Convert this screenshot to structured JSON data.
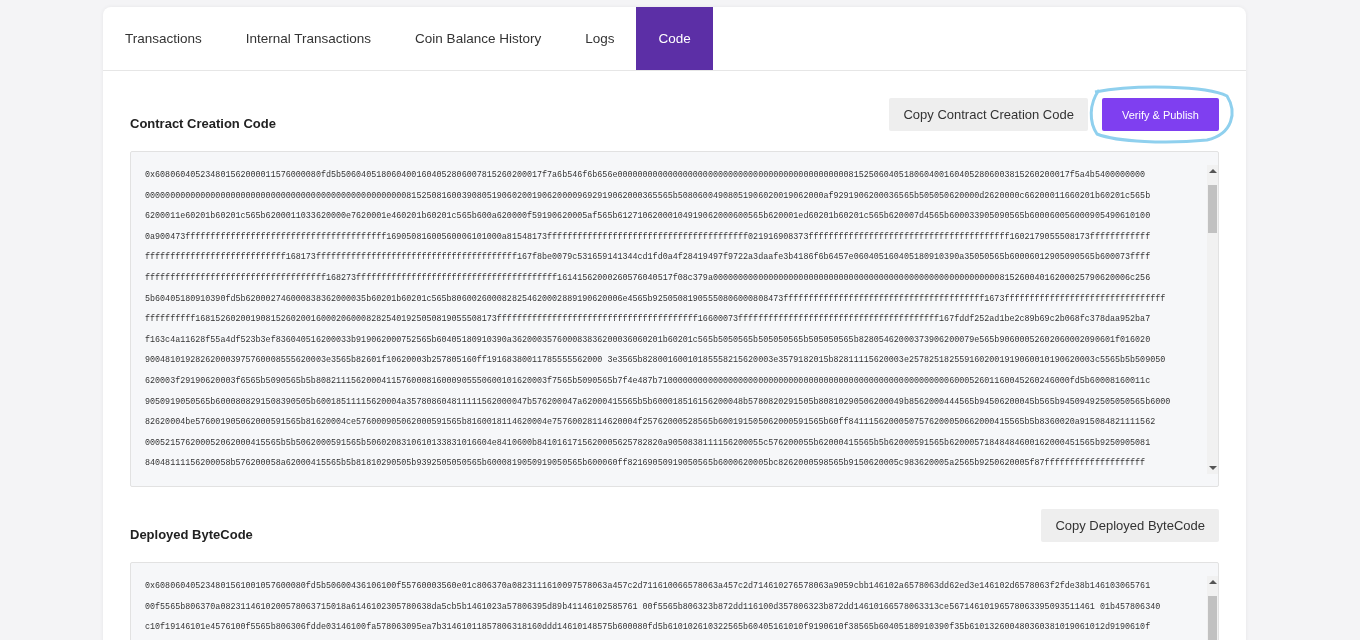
{
  "tabs": [
    {
      "label": "Transactions",
      "selected": false
    },
    {
      "label": "Internal Transactions",
      "selected": false
    },
    {
      "label": "Coin Balance History",
      "selected": false
    },
    {
      "label": "Logs",
      "selected": false
    },
    {
      "label": "Code",
      "selected": true
    }
  ],
  "sections": [
    {
      "title": "Contract Creation Code",
      "buttons": [
        {
          "label": "Copy Contract Creation Code",
          "kind": "secondary",
          "annotated": false
        },
        {
          "label": "Verify & Publish",
          "kind": "primary",
          "annotated": true
        }
      ],
      "code_lines": [
        "0x608060405234801562000011576000080fd5b5060405180604001604052806007815260200017f7a6b546f6b656e000000000000000000000000000000000000000000000081525060405180604001604052806003815260200017f5a4b5400000000",
        "000000000000000000000000000000000000000000000000000081525081600390805190602001906200009692919062000365565b50806004908051906020019062000af9291906200036565b505050620000d2620000c66200011660201b60201c565b",
        "6200011e60201b60201c565b6200011033620000e7620001e460201b60201c565b600a620000f59190620005af565b61271062000104919062000600565b620001ed60201b60201c565b620007d4565b600033905090565b600060056000905490610100",
        "0a900473ffffffffffffffffffffffffffffffffffffffff16905081600560006101000a81548173ffffffffffffffffffffffffffffffffffffffff021916908373ffffffffffffffffffffffffffffffffffffffff1602179055508173ffffffffffff",
        "ffffffffffffffffffffffffffff168173ffffffffffffffffffffffffffffffffffffffff167f8be0079c531659141344cd1fd0a4f28419497f9722a3daafe3b4186f6b6457e060405160405180910390a35050565b60006012905090565b600073ffff",
        "ffffffffffffffffffffffffffffffffffff168273ffffffffffffffffffffffffffffffffffffffff16141562000260576040517f08c379a00000000000000000000000000000000000000000000000000000000081526004016200025790620006c256",
        "5b60405180910390fd5b620002746000838362000035b60201b60201c565b8060026000828254620002889190620006e4565b92505081905550806000808473ffffffffffffffffffffffffffffffffffffffff1673ffffffffffffffffffffffffffffffff",
        "ffffffffff168152602001908152602001600020600082825401925050819055508173ffffffffffffffffffffffffffffffffffffffff16600073ffffffffffffffffffffffffffffffffffffffff167fddf252ad1be2c89b69c2b068fc378daa952ba7",
        "f163c4a11628f55a4df523b3ef836040516200033b919062000752565b60405180910390a362000357600083836200036060201b60201c565b5050565b505050565b505050565b82805462000373906200079e565b90600052602060002090601f016020",
        "900481019282620003975760008555620003e3565b82601f10620003b257805160ff19168380011785555562000 3e3565b82800160010185558215620003e3579182015b82811115620003e2578251825591602001919060010190620003c5565b5b509050",
        "620003f29190620003f6565b5090565b5b8082111562000411576000816000905550600101620003f7565b5090565b7f4e487b7100000000000000000000000000000000000000000000000000000000600052601160045260246000fd5b60008160011c",
        "9050919050565b6000808291508390505b60018511115620004a357808604811111562000047b576200047a62000415565b5b600018516156200048b5780820291505b80810290506200049b8562000444565b94506200045b565b94509492505050565b6000",
        "82620004be576001905062000591565b81620004ce576000905062000591565b8160018114620004e75760028114620004f25762000528565b600191505062000591565b60ff84111562000507576200050662000415565b5b8360020a915084821111562",
        "000521576200052062000415565b5b5062000591565b5060208310610133831016604e8410600b8410161715620005625782820a9050838111156200055c576200055b62000415565b5b62000591565b62000571848484600162000451565b9250905081",
        "84048111156200058b576200058a62000415565b5b81810290505b9392505050565b6000819050919050565b600060ff82169050919050565b6000620005bc8262000598565b9150620005c983620005a2565b9250620005f87ffffffffffffffffffff"
      ],
      "scrollbar": true
    },
    {
      "title": "Deployed ByteCode",
      "buttons": [
        {
          "label": "Copy Deployed ByteCode",
          "kind": "secondary",
          "annotated": false
        }
      ],
      "code_lines": [
        "0x608060405234801561001057600080fd5b50600436106100f55760003560e01c806370a0823111610097578063a457c2d711610066578063a457c2d714610276578063a9059cbb146102a6578063dd62ed3e146102d6578063f2fde38b146103065761",
        "00f5565b806370a0823114610200578063715018a6146102305780638da5cb5b1461023a57806395d89b41146102585761 00f5565b806323b872dd116100d357806323b872dd14610166578063313ce56714610196578063395093511461 01b457806340",
        "c10f19146101e4576100f5565b806306fdde03146100fa578063095ea7b31461011857806318160ddd14610148575b600080fd5b610102610322565b60405161010f9190610f38565b60405180910390f35b610132600480360381019061012d9190610f"
      ],
      "scrollbar": true
    }
  ]
}
